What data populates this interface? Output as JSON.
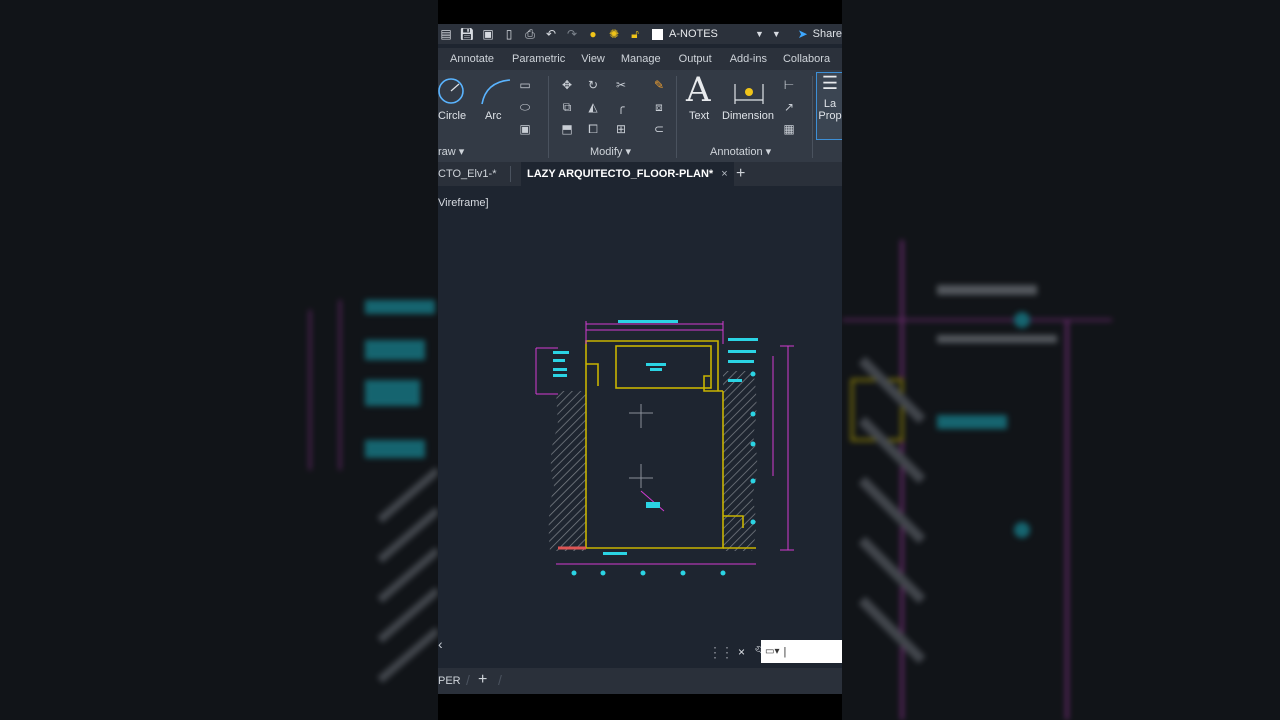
{
  "quick_access": {
    "layer_name": "A-NOTES",
    "share_label": "Share",
    "icons": [
      "new-icon",
      "save-icon",
      "save-as-icon",
      "open-icon",
      "print-icon",
      "undo-icon",
      "redo-icon",
      "lightbulb-icon",
      "sun-icon",
      "lock-icon"
    ]
  },
  "ribbon_tabs": [
    "Annotate",
    "Parametric",
    "View",
    "Manage",
    "Output",
    "Add-ins",
    "Collabora"
  ],
  "ribbon": {
    "draw": {
      "circle": "Circle",
      "arc": "Arc",
      "panel": "raw"
    },
    "modify": {
      "panel": "Modify"
    },
    "annotation": {
      "text": "Text",
      "dimension": "Dimension",
      "panel": "Annotation"
    },
    "layers": {
      "label_line1": "La",
      "label_line2": "Prop"
    }
  },
  "doc_tabs": {
    "first": "CTO_Elv1-*",
    "active": "LAZY ARQUITECTO_FLOOR-PLAN*",
    "close": "×",
    "add": "+"
  },
  "viewport_label": "Vireframe]",
  "command": {
    "close": "×"
  },
  "layout_tabs": {
    "paper": "PER",
    "add": "+"
  },
  "colors": {
    "accent": "#3ea8ff",
    "wall": "#c8b400",
    "dim": "#d13bd1",
    "annot": "#2bd4e4",
    "bg": "#1e2530"
  }
}
